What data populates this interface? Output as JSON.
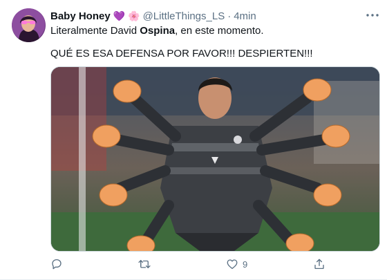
{
  "tweet": {
    "display_name": "Baby Honey",
    "name_emojis": [
      "💜",
      "🌸"
    ],
    "handle": "@LittleThings_LS",
    "separator": "·",
    "time": "4min",
    "text_line1_pre": "Literalmente David ",
    "text_line1_bold": "Ospina",
    "text_line1_post": ", en este momento.",
    "text_line2": "QUÉ ES ESA DEFENSA POR FAVOR!!! DESPIERTEN!!!",
    "media_icon": "goalkeeper-with-many-arms-photo",
    "like_count": "9"
  },
  "icons": {
    "more": "more-horizontal-icon",
    "reply": "reply-icon",
    "retweet": "retweet-icon",
    "like": "heart-icon",
    "share": "share-icon"
  },
  "colors": {
    "text": "#0f1419",
    "secondary": "#5b7083",
    "jersey": "#3c3f44",
    "glove": "#f0a060"
  }
}
